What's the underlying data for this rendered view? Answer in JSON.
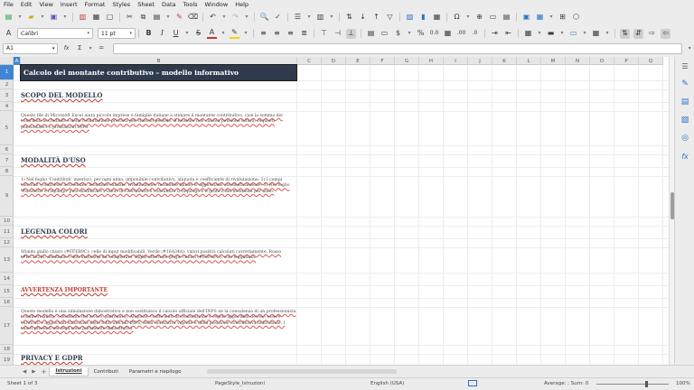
{
  "menubar": [
    "File",
    "Edit",
    "View",
    "Insert",
    "Format",
    "Styles",
    "Sheet",
    "Data",
    "Tools",
    "Window",
    "Help"
  ],
  "toolbar2": {
    "font_name": "Calibri",
    "font_size": "11 pt",
    "bold": "B",
    "italic": "I",
    "underline": "U",
    "currency": "$",
    "percent": "%",
    "number_format": "0.0"
  },
  "formula_bar": {
    "cell_ref": "A1",
    "sigma": "Σ",
    "equals": "=",
    "fx": "fx",
    "content": ""
  },
  "columns": [
    "A",
    "B",
    "C",
    "D",
    "E",
    "F",
    "G",
    "H",
    "I",
    "J",
    "K",
    "L",
    "M",
    "N",
    "O",
    "P",
    "Q"
  ],
  "rows": [
    "1",
    "2",
    "3",
    "4",
    "5",
    "6",
    "7",
    "8",
    "9",
    "10",
    "11",
    "12",
    "13",
    "14",
    "15",
    "16",
    "17",
    "18",
    "19"
  ],
  "sheet_content": {
    "title": "Calcolo del montante contributivo – modello informativo",
    "scopo_heading": "SCOPO DEL MODELLO",
    "scopo_text": "Questo file di Microsoft Excel aiuta piccole imprese e famiglie italiane a stimare il montante contributivo, cioè la somma dei contributi accreditati e della rivalutazione prevista per ciascun periodo. Il modello non calcola pensione futura, requisiti pensionistici o prestazioni INPS.",
    "modalita_heading": "MODALITÀ D'USO",
    "modalita_text": "1) Nel foglio 'Contributi' inserisci, per ogni anno, imponibile contributivo, aliquota e coefficiente di rivalutazione. 2) I campi calcolati (contributi accreditati, montante iniziale, rivalutazione, montante finale) si aggiornano automaticamente. 3) Nel foglio 'Parametri e riepilogo' puoi modificare i valori di riferimento e consultare il riepilogo e il grafico del montante per anno.",
    "legenda_heading": "LEGENDA COLORI",
    "legenda_text": "Sfondo giallo chiaro (#FFEB9C): celle di input modificabili. Verde (#16A34A): valori positivi calcolati correttamente. Rosso (#DC2626): anomalie o dati mancanti da completare. Righe alternate grigio chiaro (#F8FAFC): solo leggibilità.",
    "avvertenza_heading": "AVVERTENZA IMPORTANTE",
    "avvertenza_text": "Questo modello è una simulazione dimostrativa e non sostituisce il calcolo ufficiale dell'INPS né la consulenza di un professionista (commercialista, consulente del lavoro, patronato). Aliquote, coefficienti di rivalutazione e regole applicabili devono essere verificati e aggiornati sulla base delle fonti ufficiali INPS, della normativa vigente e della posizione contributiva individuale. I valori presenti nei fogli sono puramente dimostrativi.",
    "privacy_heading": "PRIVACY E GDPR"
  },
  "tabs": {
    "nav": [
      "◀",
      "▶"
    ],
    "add": "+",
    "sheets": [
      "Istruzioni",
      "Contributi",
      "Parametri e riepilogo"
    ]
  },
  "status": {
    "sheet": "Sheet 1 of 3",
    "page_style": "PageStyle_Istruzioni",
    "language": "English (USA)",
    "summary": "Average: ; Sum: 0",
    "zoom": "100%"
  },
  "colors": {
    "title_bg": "#2f3b4c",
    "heading": "#2f3b4c",
    "warning": "#c0392b",
    "selection": "#3f85d3",
    "icon_blue": "#2a72c8"
  }
}
